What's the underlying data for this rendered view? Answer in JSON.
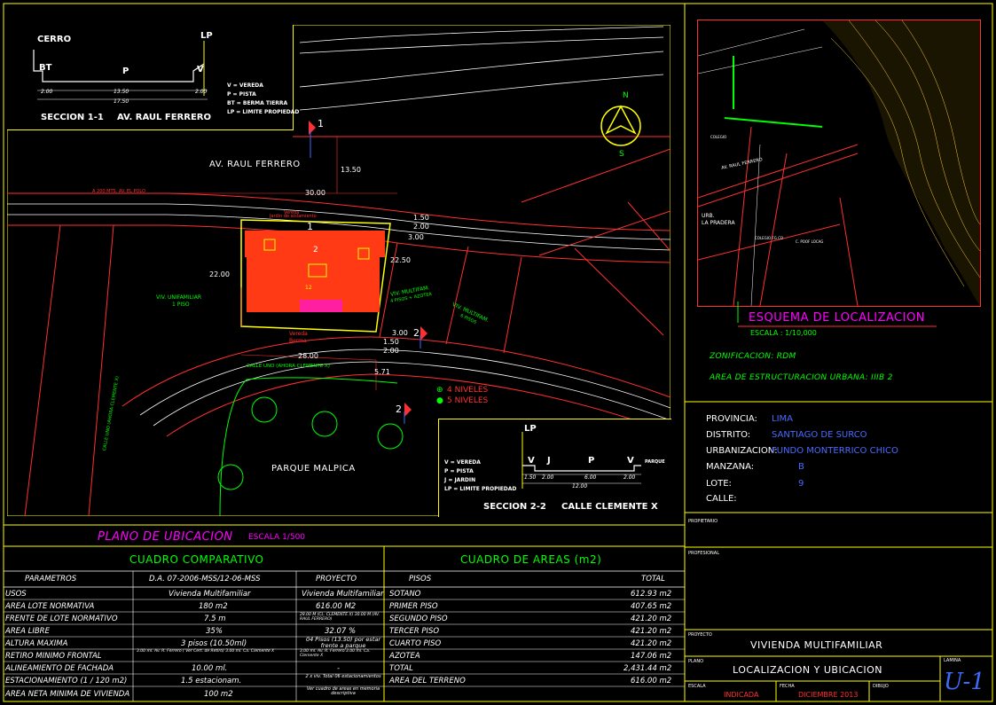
{
  "plan": {
    "title": "PLANO DE UBICACION",
    "scale": "ESCALA 1/500",
    "street_top": "AV. RAUL FERRERO",
    "street_bottom": "CALLE UNO (AHORA CLEMENTE X)",
    "street_side": "CALLE UNO (AHORA CLEMENTE X)",
    "side_street_note": "A 200 MTS. AV. EL POLO",
    "park": "PARQUE MALPICA",
    "vereda": "Vereda",
    "jardin": "Jardin de aislamiento",
    "berma": "Berma",
    "left_lot": [
      "VIV. UNIFAMILIAR",
      "1 PISO"
    ],
    "right_lot1": [
      "VIV. MULTIFAM.",
      "4 PISOS + AZOTEA"
    ],
    "right_lot2": [
      "VIV. MULTIFAM.",
      "6 PISOS"
    ],
    "lot_number": "12",
    "north": "N",
    "south": "S",
    "section_marks": [
      "1",
      "1",
      "2",
      "2",
      "2"
    ],
    "dims": {
      "d1350": "13.50",
      "d3000": "30.00",
      "d2200": "22.00",
      "d2250": "22.50",
      "d2800": "28.00",
      "d150a": "1.50",
      "d200a": "2.00",
      "d300a": "3.00",
      "d300b": "3.00",
      "d150b": "1.50",
      "d200b": "2.00",
      "d571": "5.71"
    },
    "levels": [
      {
        "marker": "⊕",
        "label": "4 NIVELES"
      },
      {
        "marker": "●",
        "label": "5 NIVELES"
      }
    ]
  },
  "section1": {
    "title": "SECCION 1-1",
    "street": "AV. RAUL FERRERO",
    "labels": [
      "CERRO",
      "LP",
      "BT",
      "P",
      "V"
    ],
    "dims": [
      "2.00",
      "13.50",
      "2.00",
      "17.50"
    ],
    "legend": [
      "V = VEREDA",
      "P = PISTA",
      "BT = BERMA TIERRA",
      "LP = LIMITE PROPIEDAD"
    ]
  },
  "section2": {
    "title": "SECCION 2-2",
    "street": "CALLE CLEMENTE X",
    "labels": [
      "LP",
      "V",
      "J",
      "P",
      "V",
      "PARQUE"
    ],
    "dims": [
      "1.50",
      "2.00",
      "6.00",
      "2.00",
      "12.00"
    ],
    "legend": [
      "V = VEREDA",
      "P = PISTA",
      "J = JARDIN",
      "LP = LIMITE PROPIEDAD"
    ]
  },
  "location_map": {
    "title": "ESQUEMA DE LOCALIZACION",
    "scale": "ESCALA : 1/10,000",
    "labels": [
      "URB.",
      "LA PRADERA",
      "AV. RAUL FERRERO",
      "COLEGIO",
      "COLEGIO FG CO",
      "C. POOF LOCAG"
    ]
  },
  "zoning": {
    "zonificacion": "ZONIFICACION: RDM",
    "area_estructuracion": "AREA DE ESTRUCTURACION URBANA: IIIB 2"
  },
  "location_info": [
    {
      "label": "PROVINCIA:",
      "value": "LIMA"
    },
    {
      "label": "DISTRITO:",
      "value": "SANTIAGO DE SURCO"
    },
    {
      "label": "URBANIZACION:",
      "value": "FUNDO MONTERRICO CHICO"
    },
    {
      "label": "MANZANA:",
      "value": "B"
    },
    {
      "label": "LOTE:",
      "value": "9"
    },
    {
      "label": "CALLE:",
      "value": ""
    }
  ],
  "cuadro_comparativo": {
    "title": "CUADRO COMPARATIVO",
    "headers": [
      "PARAMETROS",
      "D.A. 07-2006-MSS/12-06-MSS",
      "PROYECTO"
    ],
    "rows": [
      [
        "USOS",
        "Vivienda Multifamiliar",
        "Vivienda Multifamiliar"
      ],
      [
        "AREA LOTE NORMATIVA",
        "180 m2",
        "616.00 M2"
      ],
      [
        "FRENTE DE LOTE NORMATIVO",
        "7.5 m",
        "28.00 M (CL. CLEMENTE X) 30.00 M (AV. RAUL FERRERO)"
      ],
      [
        "AREA LIBRE",
        "35%",
        "32.07 %"
      ],
      [
        "ALTURA MAXIMA",
        "3 pisos (10.50ml)",
        "04 Pisos (13.50) por estar frente a parque"
      ],
      [
        "RETIRO MINIMO FRONTAL",
        "3.00 ml. Av. R. Ferrero ( Ver Cert. de Retiro) 3.00 ml. Ca. Clemente X",
        "3.00 ml. Av. R. Ferrero 3.00 ml. Ca. Clemente X"
      ],
      [
        "ALINEAMIENTO DE FACHADA",
        "10.00 ml.",
        "-"
      ],
      [
        "ESTACIONAMIENTO (1 / 120 m2)",
        "1.5 estacionam.",
        "2 x viv. Total 06 estacionamientos"
      ],
      [
        "AREA NETA MINIMA DE VIVIENDA",
        "100 m2",
        "Ver cuadro de areas en memoria descriptiva"
      ]
    ]
  },
  "cuadro_areas": {
    "title": "CUADRO DE AREAS (m2)",
    "headers": [
      "PISOS",
      "TOTAL"
    ],
    "rows": [
      [
        "SOTANO",
        "612.93 m2"
      ],
      [
        "PRIMER PISO",
        "407.65 m2"
      ],
      [
        "SEGUNDO PISO",
        "421.20 m2"
      ],
      [
        "TERCER PISO",
        "421.20 m2"
      ],
      [
        "CUARTO PISO",
        "421.20 m2"
      ],
      [
        "AZOTEA",
        "147.06 m2"
      ],
      [
        "TOTAL",
        "2,431.44 m2"
      ],
      [
        "AREA DEL TERRENO",
        "616.00 m2"
      ]
    ]
  },
  "title_block": {
    "propietario_label": "PROPIETARIO",
    "profesional_label": "PROFESIONAL",
    "proyecto_label": "PROYECTO",
    "proyecto_value": "VIVIENDA MULTIFAMILIAR",
    "plano_label": "PLANO",
    "plano_value": "LOCALIZACION Y UBICACION",
    "lamina_label": "LAMINA",
    "lamina_value": "U-1",
    "escala_label": "ESCALA",
    "escala_value": "INDICADA",
    "fecha_label": "FECHA",
    "fecha_value": "DICIEMBRE 2013",
    "dibujo_label": "DIBUJO",
    "dibujo_value": ""
  }
}
